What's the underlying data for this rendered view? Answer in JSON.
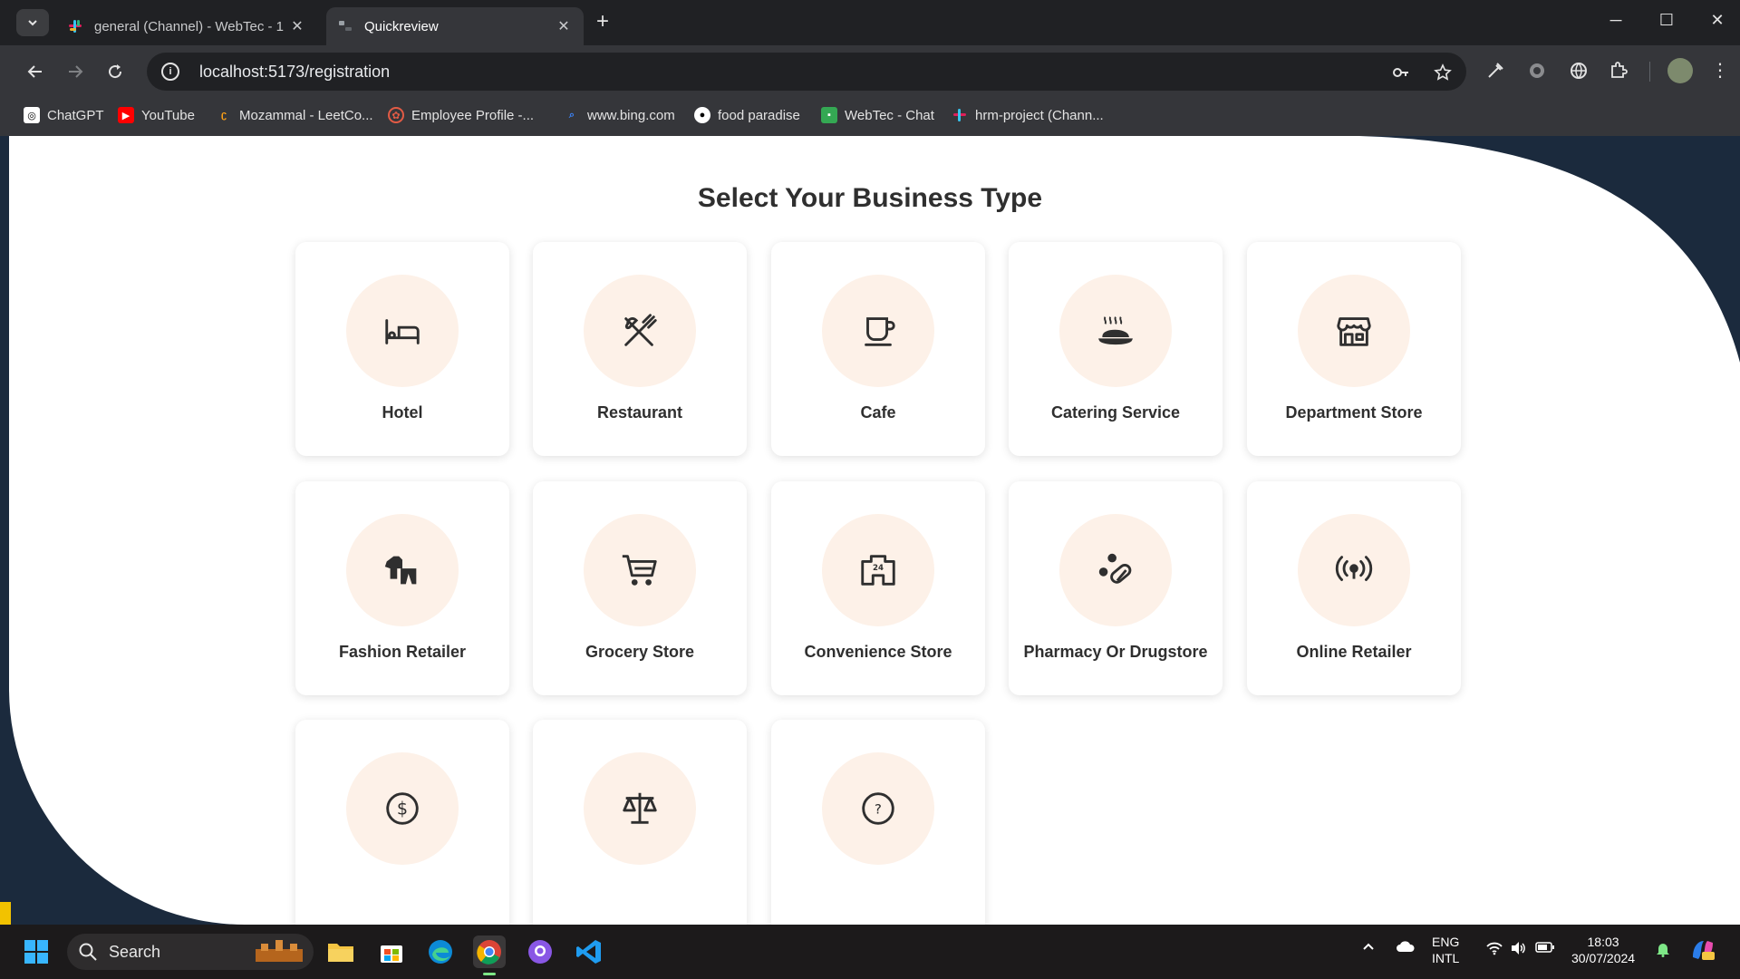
{
  "browser": {
    "tabs": [
      {
        "title": "general (Channel) - WebTec - 1",
        "active": false
      },
      {
        "title": "Quickreview",
        "active": true
      }
    ],
    "url": "localhost:5173/registration",
    "bookmarks": [
      "ChatGPT",
      "YouTube",
      "Mozammal - LeetCo...",
      "Employee Profile -...",
      "www.bing.com",
      "food paradise",
      "WebTec - Chat",
      "hrm-project (Chann..."
    ]
  },
  "page": {
    "heading": "Select Your Business Type",
    "business_types": [
      {
        "label": "Hotel",
        "icon": "bed-icon"
      },
      {
        "label": "Restaurant",
        "icon": "fork-knife-icon"
      },
      {
        "label": "Cafe",
        "icon": "coffee-cup-icon"
      },
      {
        "label": "Catering Service",
        "icon": "catering-dish-icon"
      },
      {
        "label": "Department Store",
        "icon": "storefront-icon"
      },
      {
        "label": "Fashion Retailer",
        "icon": "clothing-icon"
      },
      {
        "label": "Grocery Store",
        "icon": "shopping-cart-icon"
      },
      {
        "label": "Convenience Store",
        "icon": "store-24-icon"
      },
      {
        "label": "Pharmacy Or Drugstore",
        "icon": "pills-icon"
      },
      {
        "label": "Online Retailer",
        "icon": "broadcast-icon"
      },
      {
        "label": "",
        "icon": "dollar-icon"
      },
      {
        "label": "",
        "icon": "scale-icon"
      },
      {
        "label": "",
        "icon": "question-icon"
      }
    ]
  },
  "taskbar": {
    "search_placeholder": "Search",
    "lang_line1": "ENG",
    "lang_line2": "INTL",
    "time": "18:03",
    "date": "30/07/2024"
  },
  "colors": {
    "accent_circle": "#fdf1e8",
    "page_background": "#1b2a3d",
    "icon_color": "#2f2f2f"
  }
}
